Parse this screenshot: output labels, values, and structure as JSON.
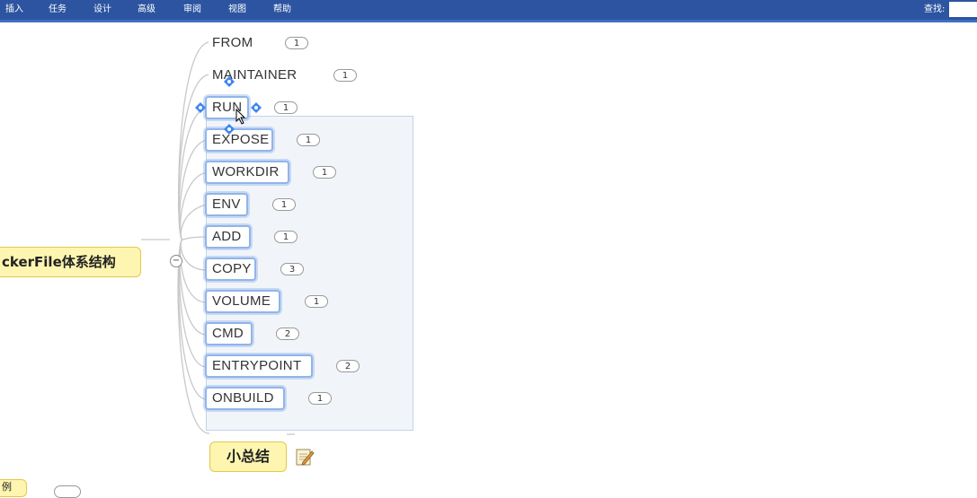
{
  "menubar": {
    "items": [
      "插入",
      "任务",
      "设计",
      "高级",
      "审阅",
      "视图",
      "帮助"
    ],
    "find_label": "查找:",
    "find_value": ""
  },
  "mindmap": {
    "root": {
      "label": "ckerFile体系结构"
    },
    "children": [
      {
        "label": "FROM",
        "count": "1"
      },
      {
        "label": "MAINTAINER",
        "count": "1"
      },
      {
        "label": "RUN",
        "count": "1"
      },
      {
        "label": "EXPOSE",
        "count": "1"
      },
      {
        "label": "WORKDIR",
        "count": "1"
      },
      {
        "label": "ENV",
        "count": "1"
      },
      {
        "label": "ADD",
        "count": "1"
      },
      {
        "label": "COPY",
        "count": "3"
      },
      {
        "label": "VOLUME",
        "count": "1"
      },
      {
        "label": "CMD",
        "count": "2"
      },
      {
        "label": "ENTRYPOINT",
        "count": "2"
      },
      {
        "label": "ONBUILD",
        "count": "1"
      }
    ],
    "summary": {
      "label": "小总结"
    },
    "partial_topic": {
      "label": "例"
    },
    "collapse_symbol": "−"
  },
  "colors": {
    "menubar": "#2c54a0",
    "topic_outline": "#8fb5ea",
    "main_topic_fill": "#fdf5b0",
    "selection_handle": "#3d86f0"
  },
  "icons": [
    "collapse-icon",
    "note-icon",
    "selection-handle-icon",
    "mouse-cursor-icon"
  ]
}
